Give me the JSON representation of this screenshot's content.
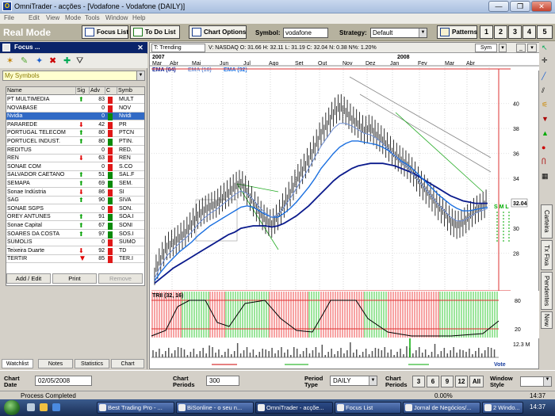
{
  "window": {
    "title": "OmniTrader - acções - [Vodafone - Vodafone (DAILY)]",
    "minimize": "—",
    "maximize": "❐",
    "close": "✕"
  },
  "menu": [
    "File",
    "Edit",
    "View",
    "Mode",
    "Tools",
    "Window",
    "Help"
  ],
  "toolbar": {
    "mode": "Real Mode",
    "focus_list": "Focus List",
    "todo_list": "To Do List",
    "chart_options": "Chart Options",
    "symbol_label": "Symbol:",
    "symbol_value": "vodafone",
    "strategy_label": "Strategy:",
    "strategy_value": "Default",
    "patterns": "Patterns",
    "pages": [
      "1",
      "2",
      "3",
      "4",
      "5"
    ]
  },
  "focus_panel": {
    "title": "Focus ...",
    "list_selector": "My Symbols",
    "columns": [
      "Name",
      "Sig",
      "Adv",
      "C",
      "Symb"
    ],
    "rows": [
      {
        "name": "PT MULTIMEDIA",
        "sig": "up",
        "adv": "83",
        "c": "red",
        "sym": "MULT"
      },
      {
        "name": "NOVABASE",
        "sig": "",
        "adv": "0",
        "c": "red",
        "sym": "NOV"
      },
      {
        "name": "Nvidia",
        "sig": "",
        "adv": "0",
        "c": "green",
        "sym": "Nvidi",
        "selected": true
      },
      {
        "name": "PARAREDE",
        "sig": "down",
        "adv": "42",
        "c": "red",
        "sym": "PR"
      },
      {
        "name": "PORTUGAL TELECOM",
        "sig": "up",
        "adv": "80",
        "c": "red",
        "sym": "PTCN"
      },
      {
        "name": "PORTUCEL INDUST.",
        "sig": "up",
        "adv": "80",
        "c": "green",
        "sym": "PTIN."
      },
      {
        "name": "REDITUS",
        "sig": "",
        "adv": "0",
        "c": "red",
        "sym": "RED."
      },
      {
        "name": "REN",
        "sig": "down",
        "adv": "63",
        "c": "red",
        "sym": "REN"
      },
      {
        "name": "SONAE COM",
        "sig": "",
        "adv": "0",
        "c": "red",
        "sym": "S.CO"
      },
      {
        "name": "SALVADOR CAETANO",
        "sig": "up",
        "adv": "51",
        "c": "green",
        "sym": "SAL.F"
      },
      {
        "name": "SEMAPA",
        "sig": "up",
        "adv": "69",
        "c": "green",
        "sym": "SEM."
      },
      {
        "name": "Sonae Indústria",
        "sig": "down",
        "adv": "86",
        "c": "red",
        "sym": "SI"
      },
      {
        "name": "SAG",
        "sig": "up",
        "adv": "90",
        "c": "green",
        "sym": "SIVA"
      },
      {
        "name": "SONAE SGPS",
        "sig": "",
        "adv": "0",
        "c": "red",
        "sym": "SON."
      },
      {
        "name": "OREY ANTUNES",
        "sig": "up",
        "adv": "91",
        "c": "green",
        "sym": "SOA.I"
      },
      {
        "name": "Sonae Capital",
        "sig": "up",
        "adv": "67",
        "c": "green",
        "sym": "SONI"
      },
      {
        "name": "SOARES DA COSTA",
        "sig": "up",
        "adv": "97",
        "c": "green",
        "sym": "SOS.I"
      },
      {
        "name": "SUMOLIS",
        "sig": "",
        "adv": "0",
        "c": "red",
        "sym": "SUMO"
      },
      {
        "name": "Teixeira Duarte",
        "sig": "down",
        "adv": "92",
        "c": "red",
        "sym": "TD"
      },
      {
        "name": "TERTIR",
        "sig": "bigdown",
        "adv": "85",
        "c": "red",
        "sym": "TER.I"
      }
    ],
    "btn_add_edit": "Add / Edit",
    "btn_print": "Print",
    "btn_remove": "Remove",
    "tabs": [
      "Watchlist",
      "Notes",
      "Statistics",
      "Chart"
    ]
  },
  "chart_header": {
    "system": "T: Trending",
    "info": "V: NASDAQ  O: 31.66  H: 32.11  L: 31.19  C: 32.04  N: 0.38  N%: 1.20%",
    "sym_btn": "Sym",
    "years": [
      "2007",
      "2008"
    ],
    "months": [
      "Mar",
      "Abr",
      "Mai",
      "Jun",
      "Jul",
      "Ago",
      "Set",
      "Out",
      "Nov",
      "Dez",
      "Jan",
      "Fev",
      "Mar",
      "Abr"
    ],
    "ema_labels": [
      "EMA (64)",
      "EMA (16)",
      "EMA (32)"
    ],
    "ema_colors": [
      "#0a1a8c",
      "#6f8fd4",
      "#1a6fe0"
    ],
    "indicator_label": "TRII (32, 16)",
    "volume_label": "12.3 M",
    "vote_label": "Vote",
    "sml_label": "S M L",
    "last_price": "32.04"
  },
  "chart_data": {
    "type": "line",
    "price_axis": {
      "ticks": [
        40,
        38,
        36,
        34,
        32,
        30,
        28
      ],
      "range": [
        25.5,
        41.5
      ]
    },
    "indicator_axis": {
      "ticks": [
        80,
        20
      ]
    },
    "series": [
      {
        "name": "EMA (64)",
        "color": "#0a1a8c"
      },
      {
        "name": "EMA (16)",
        "color": "#6f8fd4"
      },
      {
        "name": "EMA (32)",
        "color": "#1a6fe0"
      }
    ],
    "price_path": [
      26.5,
      27.5,
      28.5,
      28.8,
      29.2,
      29.6,
      30.3,
      31,
      31.4,
      31.7,
      31.9,
      32.4,
      32.8,
      33.3,
      33.6,
      32.9,
      32,
      31.2,
      30.6,
      30.3,
      30.9,
      31.9,
      32.8,
      33.8,
      34.6,
      35.5,
      36.5,
      37.6,
      38.3,
      39.2,
      39.7,
      39.3,
      38.7,
      38.3,
      37.8,
      38,
      37.4,
      37,
      36.4,
      35.8,
      35.4,
      35,
      34.4,
      33.6,
      33,
      32.4,
      31.7,
      31.2,
      30.5,
      30.2,
      30.4,
      30.9,
      31.4,
      31.7,
      32.04
    ],
    "ema16_path": [
      26,
      27,
      27.8,
      28.3,
      28.8,
      29.2,
      29.7,
      30.3,
      30.8,
      31.2,
      31.5,
      31.9,
      32.3,
      32.7,
      33,
      32.8,
      32.3,
      31.7,
      31.2,
      30.9,
      31.1,
      31.7,
      32.4,
      33.2,
      34,
      34.8,
      35.7,
      36.6,
      37.3,
      38,
      38.4,
      38.4,
      38.2,
      37.9,
      37.6,
      37.5,
      37.2,
      36.8,
      36.3,
      35.8,
      35.3,
      34.9,
      34.3,
      33.7,
      33.1,
      32.5,
      31.9,
      31.4,
      30.9,
      30.6,
      30.6,
      30.9,
      31.2,
      31.4,
      31.6
    ],
    "ema32_path": [
      25.8,
      26.5,
      27.1,
      27.6,
      28.1,
      28.5,
      28.9,
      29.4,
      29.8,
      30.2,
      30.5,
      30.8,
      31.1,
      31.4,
      31.7,
      31.8,
      31.7,
      31.4,
      31.1,
      30.9,
      30.9,
      31.2,
      31.6,
      32.1,
      32.7,
      33.3,
      34,
      34.8,
      35.4,
      36,
      36.5,
      36.8,
      37,
      37,
      36.9,
      36.8,
      36.7,
      36.5,
      36.2,
      35.8,
      35.4,
      35.1,
      34.7,
      34.2,
      33.7,
      33.2,
      32.7,
      32.3,
      31.9,
      31.6,
      31.4,
      31.4,
      31.5,
      31.6,
      31.7
    ],
    "ema64_path": [
      25.6,
      26,
      26.4,
      26.8,
      27.1,
      27.4,
      27.7,
      28,
      28.3,
      28.6,
      28.9,
      29.2,
      29.5,
      29.7,
      30,
      30.1,
      30.2,
      30.2,
      30.2,
      30.1,
      30.2,
      30.4,
      30.7,
      31,
      31.4,
      31.8,
      32.3,
      32.8,
      33.3,
      33.8,
      34.2,
      34.5,
      34.8,
      35,
      35.1,
      35.2,
      35.2,
      35.2,
      35.1,
      35,
      34.8,
      34.6,
      34.4,
      34.1,
      33.8,
      33.5,
      33.2,
      32.9,
      32.6,
      32.4,
      32.2,
      32.1,
      32,
      32,
      32
    ]
  },
  "bottom": {
    "chart_date_label": "Chart Date",
    "chart_date_value": "02/05/2008",
    "chart_periods_label": "Chart Periods",
    "chart_periods_value": "300",
    "period_type_label": "Period Type",
    "period_type_value": "DAILY",
    "chart_periods2_label": "Chart Periods",
    "period_buttons": [
      "3",
      "6",
      "9",
      "12",
      "All"
    ],
    "window_style_label": "Window Style"
  },
  "status": {
    "left": "Process Completed",
    "pct": "0.00%",
    "time": "14:37"
  },
  "right_tabs": [
    "Carteira",
    "Tx Fixa",
    "Pendentes",
    "New"
  ],
  "taskbar": {
    "items": [
      "Best Trading Pro - ...",
      "BiSonline - o seu n...",
      "OmniTrader - acçõe...",
      "Focus List",
      "Jornal de Negócios/...",
      "2 Windo..."
    ],
    "clock": "14:37"
  }
}
